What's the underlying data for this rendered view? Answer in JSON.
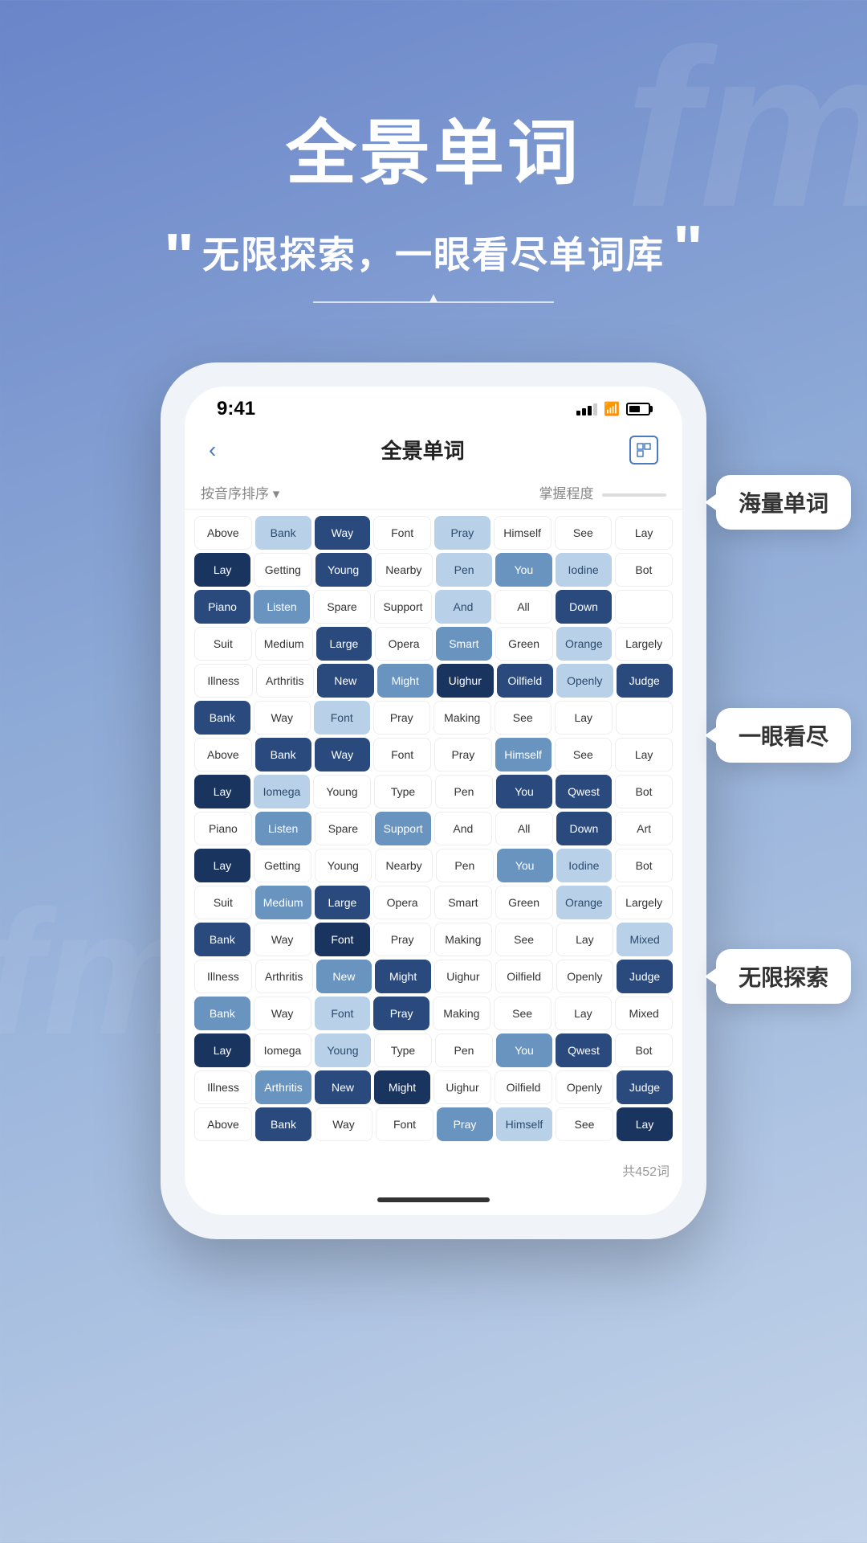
{
  "background": {
    "deco1": "fm",
    "deco2": "fm"
  },
  "header": {
    "main_title": "全景单词",
    "quote_left": "“",
    "quote_right": "”",
    "subtitle": "无限探索，一眼看尽单词库",
    "bird_deco": true
  },
  "phone": {
    "status_bar": {
      "time": "9:41",
      "signal": "▋▋▋",
      "wifi": "wifi",
      "battery": "battery"
    },
    "nav": {
      "back": "<",
      "title": "全景单词",
      "icon": "⊡"
    },
    "sort_label": "按音序排序 ▾",
    "mastery_label": "掌握程度",
    "word_rows": [
      [
        {
          "text": "Above",
          "color": "c-white"
        },
        {
          "text": "Bank",
          "color": "c-light"
        },
        {
          "text": "Way",
          "color": "c-dark"
        },
        {
          "text": "Font",
          "color": "c-white"
        },
        {
          "text": "Pray",
          "color": "c-light"
        },
        {
          "text": "Himself",
          "color": "c-white"
        },
        {
          "text": "See",
          "color": "c-white"
        },
        {
          "text": "Lay",
          "color": "c-white"
        }
      ],
      [
        {
          "text": "Lay",
          "color": "c-darker"
        },
        {
          "text": "Getting",
          "color": "c-white"
        },
        {
          "text": "Young",
          "color": "c-dark"
        },
        {
          "text": "Nearby",
          "color": "c-white"
        },
        {
          "text": "Pen",
          "color": "c-light"
        },
        {
          "text": "You",
          "color": "c-mid"
        },
        {
          "text": "Iodine",
          "color": "c-light"
        },
        {
          "text": "Bot",
          "color": "c-white"
        }
      ],
      [
        {
          "text": "Piano",
          "color": "c-dark"
        },
        {
          "text": "Listen",
          "color": "c-mid"
        },
        {
          "text": "Spare",
          "color": "c-white"
        },
        {
          "text": "Support",
          "color": "c-white"
        },
        {
          "text": "And",
          "color": "c-light"
        },
        {
          "text": "All",
          "color": "c-white"
        },
        {
          "text": "Down",
          "color": "c-dark"
        },
        {
          "text": "＿",
          "color": "c-white"
        }
      ],
      [
        {
          "text": "Suit",
          "color": "c-white"
        },
        {
          "text": "Medium",
          "color": "c-white"
        },
        {
          "text": "Large",
          "color": "c-dark"
        },
        {
          "text": "Opera",
          "color": "c-white"
        },
        {
          "text": "Smart",
          "color": "c-mid"
        },
        {
          "text": "Green",
          "color": "c-white"
        },
        {
          "text": "Orange",
          "color": "c-light"
        },
        {
          "text": "Largely",
          "color": "c-white"
        }
      ],
      [
        {
          "text": "Illness",
          "color": "c-white"
        },
        {
          "text": "Arthritis",
          "color": "c-white"
        },
        {
          "text": "New",
          "color": "c-dark"
        },
        {
          "text": "Might",
          "color": "c-mid"
        },
        {
          "text": "Uighur",
          "color": "c-darker"
        },
        {
          "text": "Oilfield",
          "color": "c-dark"
        },
        {
          "text": "Openly",
          "color": "c-light"
        },
        {
          "text": "Judge",
          "color": "c-dark"
        }
      ],
      [
        {
          "text": "Bank",
          "color": "c-dark"
        },
        {
          "text": "Way",
          "color": "c-white"
        },
        {
          "text": "Font",
          "color": "c-light"
        },
        {
          "text": "Pray",
          "color": "c-white"
        },
        {
          "text": "Making",
          "color": "c-white"
        },
        {
          "text": "See",
          "color": "c-white"
        },
        {
          "text": "Lay",
          "color": "c-white"
        },
        {
          "text": "＿",
          "color": "c-white"
        }
      ],
      [
        {
          "text": "Above",
          "color": "c-white"
        },
        {
          "text": "Bank",
          "color": "c-dark"
        },
        {
          "text": "Way",
          "color": "c-dark"
        },
        {
          "text": "Font",
          "color": "c-white"
        },
        {
          "text": "Pray",
          "color": "c-white"
        },
        {
          "text": "Himself",
          "color": "c-mid"
        },
        {
          "text": "See",
          "color": "c-white"
        },
        {
          "text": "Lay",
          "color": "c-white"
        }
      ],
      [
        {
          "text": "Lay",
          "color": "c-darker"
        },
        {
          "text": "Iomega",
          "color": "c-light"
        },
        {
          "text": "Young",
          "color": "c-white"
        },
        {
          "text": "Type",
          "color": "c-white"
        },
        {
          "text": "Pen",
          "color": "c-white"
        },
        {
          "text": "You",
          "color": "c-dark"
        },
        {
          "text": "Qwest",
          "color": "c-dark"
        },
        {
          "text": "Bot",
          "color": "c-white"
        }
      ],
      [
        {
          "text": "Piano",
          "color": "c-white"
        },
        {
          "text": "Listen",
          "color": "c-mid"
        },
        {
          "text": "Spare",
          "color": "c-white"
        },
        {
          "text": "Support",
          "color": "c-mid"
        },
        {
          "text": "And",
          "color": "c-white"
        },
        {
          "text": "All",
          "color": "c-white"
        },
        {
          "text": "Down",
          "color": "c-dark"
        },
        {
          "text": "Art",
          "color": "c-white"
        }
      ],
      [
        {
          "text": "Lay",
          "color": "c-darker"
        },
        {
          "text": "Getting",
          "color": "c-white"
        },
        {
          "text": "Young",
          "color": "c-white"
        },
        {
          "text": "Nearby",
          "color": "c-white"
        },
        {
          "text": "Pen",
          "color": "c-white"
        },
        {
          "text": "You",
          "color": "c-mid"
        },
        {
          "text": "Iodine",
          "color": "c-light"
        },
        {
          "text": "Bot",
          "color": "c-white"
        }
      ],
      [
        {
          "text": "Suit",
          "color": "c-white"
        },
        {
          "text": "Medium",
          "color": "c-mid"
        },
        {
          "text": "Large",
          "color": "c-dark"
        },
        {
          "text": "Opera",
          "color": "c-white"
        },
        {
          "text": "Smart",
          "color": "c-white"
        },
        {
          "text": "Green",
          "color": "c-white"
        },
        {
          "text": "Orange",
          "color": "c-light"
        },
        {
          "text": "Largely",
          "color": "c-white"
        }
      ],
      [
        {
          "text": "Bank",
          "color": "c-dark"
        },
        {
          "text": "Way",
          "color": "c-white"
        },
        {
          "text": "Font",
          "color": "c-darker"
        },
        {
          "text": "Pray",
          "color": "c-white"
        },
        {
          "text": "Making",
          "color": "c-white"
        },
        {
          "text": "See",
          "color": "c-white"
        },
        {
          "text": "Lay",
          "color": "c-white"
        },
        {
          "text": "Mixed",
          "color": "c-light"
        }
      ],
      [
        {
          "text": "Illness",
          "color": "c-white"
        },
        {
          "text": "Arthritis",
          "color": "c-white"
        },
        {
          "text": "New",
          "color": "c-mid"
        },
        {
          "text": "Might",
          "color": "c-dark"
        },
        {
          "text": "Uighur",
          "color": "c-white"
        },
        {
          "text": "Oilfield",
          "color": "c-white"
        },
        {
          "text": "Openly",
          "color": "c-white"
        },
        {
          "text": "Judge",
          "color": "c-dark"
        }
      ],
      [
        {
          "text": "Bank",
          "color": "c-mid"
        },
        {
          "text": "Way",
          "color": "c-white"
        },
        {
          "text": "Font",
          "color": "c-light"
        },
        {
          "text": "Pray",
          "color": "c-dark"
        },
        {
          "text": "Making",
          "color": "c-white"
        },
        {
          "text": "See",
          "color": "c-white"
        },
        {
          "text": "Lay",
          "color": "c-white"
        },
        {
          "text": "Mixed",
          "color": "c-white"
        }
      ],
      [
        {
          "text": "Lay",
          "color": "c-darker"
        },
        {
          "text": "Iomega",
          "color": "c-white"
        },
        {
          "text": "Young",
          "color": "c-light"
        },
        {
          "text": "Type",
          "color": "c-white"
        },
        {
          "text": "Pen",
          "color": "c-white"
        },
        {
          "text": "You",
          "color": "c-mid"
        },
        {
          "text": "Qwest",
          "color": "c-dark"
        },
        {
          "text": "Bot",
          "color": "c-white"
        }
      ],
      [
        {
          "text": "Illness",
          "color": "c-white"
        },
        {
          "text": "Arthritis",
          "color": "c-mid"
        },
        {
          "text": "New",
          "color": "c-dark"
        },
        {
          "text": "Might",
          "color": "c-darker"
        },
        {
          "text": "Uighur",
          "color": "c-white"
        },
        {
          "text": "Oilfield",
          "color": "c-white"
        },
        {
          "text": "Openly",
          "color": "c-white"
        },
        {
          "text": "Judge",
          "color": "c-dark"
        }
      ],
      [
        {
          "text": "Above",
          "color": "c-white"
        },
        {
          "text": "Bank",
          "color": "c-dark"
        },
        {
          "text": "Way",
          "color": "c-white"
        },
        {
          "text": "Font",
          "color": "c-white"
        },
        {
          "text": "Pray",
          "color": "c-mid"
        },
        {
          "text": "Himself",
          "color": "c-light"
        },
        {
          "text": "See",
          "color": "c-white"
        },
        {
          "text": "Lay",
          "color": "c-darker"
        }
      ]
    ],
    "footer": "共452词"
  },
  "callouts": [
    {
      "text": "海量单词",
      "position": "top"
    },
    {
      "text": "一眼看尽",
      "position": "middle"
    },
    {
      "text": "无限探索",
      "position": "bottom"
    }
  ]
}
